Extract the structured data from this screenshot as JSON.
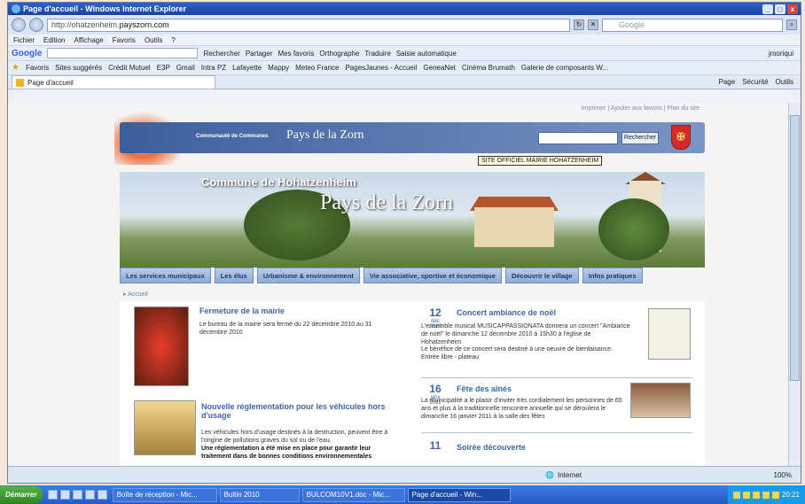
{
  "window": {
    "title": "Page d'accueil - Windows Internet Explorer",
    "controls": [
      "_",
      "□",
      "x"
    ]
  },
  "address": {
    "url_prefix": "http://ohatzenheim.",
    "url_domain": "payszorn.com",
    "search_placeholder": "Google"
  },
  "menu": [
    "Fichier",
    "Edition",
    "Affichage",
    "Favoris",
    "Outils",
    "?"
  ],
  "googlebar": {
    "logo": "Google",
    "buttons": [
      "Rechercher",
      "Partager",
      "Mes favoris",
      "Orthographe",
      "Traduire",
      "Saisie automatique"
    ],
    "user": "jmoriqui"
  },
  "favbar": {
    "label": "Favoris",
    "items": [
      "Sites suggérés",
      "Crédit Mutuel",
      "E3P",
      "Gmail",
      "Intra PZ",
      "Lafayette",
      "Mappy",
      "Meteo France",
      "PagesJaunes - Accueil",
      "GeneaNet",
      "Cinéma Brumath",
      "Galerie de composants W..."
    ]
  },
  "tab": {
    "label": "Page d'accueil",
    "tools": [
      "Page",
      "Sécurité",
      "Outils"
    ]
  },
  "site": {
    "toplinks": "Imprimer | Ajouter aux favoris | Plan du site",
    "cc_label": "Communauté de Communes",
    "banner_title": "Pays de la Zorn",
    "search_button": "Rechercher",
    "tooltip": "SITE OFFICIEL MAIRIE HOHATZENHEIM",
    "hero_commune": "Commune de Hohatzenheim",
    "hero_pays": "Pays de la Zorn",
    "nav": [
      "Les services municipaux",
      "Les élus",
      "Urbanisme & environnement",
      "Vie associative, sportive et économique",
      "Découvrir le village",
      "Infos pratiques"
    ],
    "breadcrumb": "Accueil"
  },
  "news": {
    "left": [
      {
        "title": "Fermeture de la mairie",
        "text": "Le bureau de la mairie sera fermé du 22 décembre 2010 au 31 décembre 2010"
      },
      {
        "title": "Nouvelle réglementation pour les véhicules hors d'usage",
        "text": "Les véhicules hors d'usage destinés à la destruction, peuvent être à l'origine de pollutions graves du sol ou de l'eau.",
        "text_bold": "Une réglementation a été mise en place pour garantir leur traitement dans de bonnes conditions environnementales"
      }
    ],
    "right": [
      {
        "day": "12",
        "month": "déc",
        "year": "2010",
        "title": "Concert ambiance de noël",
        "text": "L'ensemble musical MUSICAPPASSIONATA donnera un concert \"Ambiance de noël\" le dimanche 12 décembre 2010 à 15h30 à l'église de Hohatzenheim.",
        "text2": "Le bénéfice de ce concert sera destiné à une oeuvre de bienfaisance. Entrée libre - plateau"
      },
      {
        "day": "16",
        "month": "janv",
        "year": "2011",
        "title": "Fête des aînés",
        "text": "La municipalité a le plaisir d'inviter très cordialement les personnes de 65 ans et plus à la traditionnelle rencontre annuelle qui se déroulera le dimanche 16 janvier 2011 à la salle des fêtes"
      },
      {
        "day": "11",
        "month": "",
        "year": "",
        "title": "Soirée découverte",
        "text": ""
      }
    ]
  },
  "status": {
    "zone": "Internet",
    "zoom": "100%"
  },
  "taskbar": {
    "start": "Démarrer",
    "tasks": [
      "Boîte de réception - Mic...",
      "Bultin 2010",
      "BULCOM10V1.doc - Mic...",
      "Page d'accueil - Win..."
    ],
    "clock": "20:21"
  }
}
